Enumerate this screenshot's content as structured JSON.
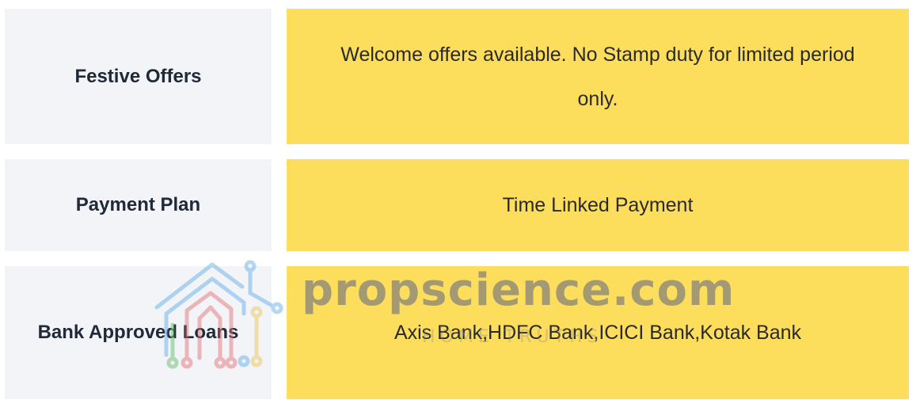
{
  "rows": [
    {
      "label": "Festive Offers",
      "value": "Welcome offers available. No Stamp duty for limited period only."
    },
    {
      "label": "Payment Plan",
      "value": "Time Linked Payment"
    },
    {
      "label": "Bank Approved Loans",
      "value": "Axis Bank,HDFC Bank,ICICI Bank,Kotak Bank"
    }
  ],
  "watermark": {
    "brand": "propscience.com",
    "tagline": "HOME TRUTHS"
  },
  "colors": {
    "label_bg": "#f3f4f8",
    "value_bg": "#fcdd5c",
    "text": "#1f2937"
  }
}
